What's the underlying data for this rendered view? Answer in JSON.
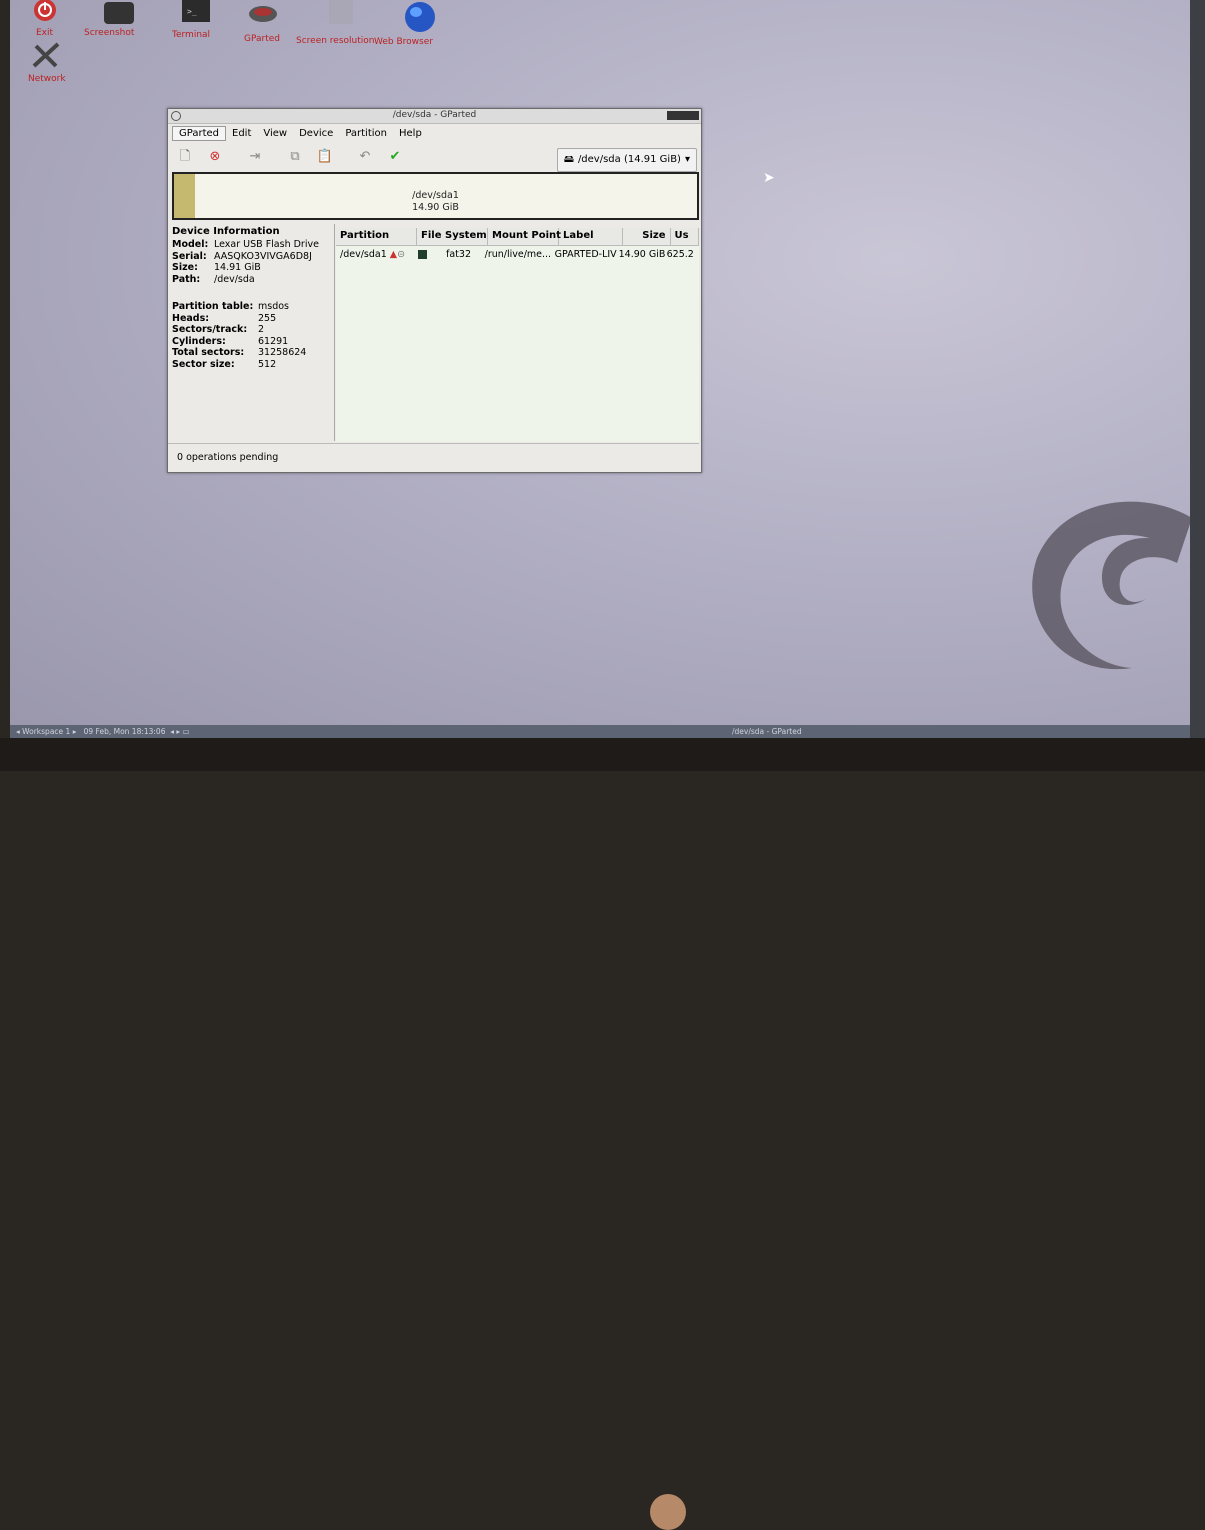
{
  "desktop": {
    "icons": [
      {
        "label": "Exit",
        "icon": "power-icon"
      },
      {
        "label": "Screenshot",
        "icon": "camera-icon"
      },
      {
        "label": "Terminal",
        "icon": "terminal-icon"
      },
      {
        "label": "GParted",
        "icon": "gparted-icon"
      },
      {
        "label": "Screen resolution",
        "icon": "monitor-icon"
      },
      {
        "label": "Web Browser",
        "icon": "globe-icon"
      },
      {
        "label": "Network",
        "icon": "network-icon"
      }
    ]
  },
  "window": {
    "title": "/dev/sda - GParted",
    "menu": [
      "GParted",
      "Edit",
      "View",
      "Device",
      "Partition",
      "Help"
    ],
    "toolbar": [
      "new-icon",
      "delete-icon",
      "resize-icon",
      "copy-icon",
      "paste-icon",
      "undo-icon",
      "apply-icon"
    ],
    "device_select": "/dev/sda (14.91 GiB)",
    "diskmap": {
      "name": "/dev/sda1",
      "size": "14.90 GiB",
      "used_fraction": 0.04
    },
    "device_info": {
      "heading": "Device Information",
      "model_k": "Model:",
      "model_v": "Lexar USB Flash Drive",
      "serial_k": "Serial:",
      "serial_v": "AASQKO3VIVGA6D8J",
      "size_k": "Size:",
      "size_v": "14.91 GiB",
      "path_k": "Path:",
      "path_v": "/dev/sda",
      "ptable_k": "Partition table:",
      "ptable_v": "msdos",
      "heads_k": "Heads:",
      "heads_v": "255",
      "sectors_k": "Sectors/track:",
      "sectors_v": "2",
      "cyl_k": "Cylinders:",
      "cyl_v": "61291",
      "total_k": "Total sectors:",
      "total_v": "31258624",
      "ssize_k": "Sector size:",
      "ssize_v": "512"
    },
    "columns": [
      "Partition",
      "File System",
      "Mount Point",
      "Label",
      "Size",
      "Us"
    ],
    "row": {
      "partition": "/dev/sda1",
      "filesystem": "fat32",
      "mount": "/run/live/me...",
      "label": "GPARTED-LIV",
      "size": "14.90 GiB",
      "used": "625.2"
    },
    "status": "0 operations pending"
  },
  "taskbar": {
    "workspace": "Workspace 1",
    "datetime": "09 Feb, Mon 18:13:06",
    "task": "/dev/sda - GParted"
  },
  "colors": {
    "used_bar": "#c5b96f",
    "fat32": "#1f3f2a",
    "exit_red": "#cc2222"
  }
}
